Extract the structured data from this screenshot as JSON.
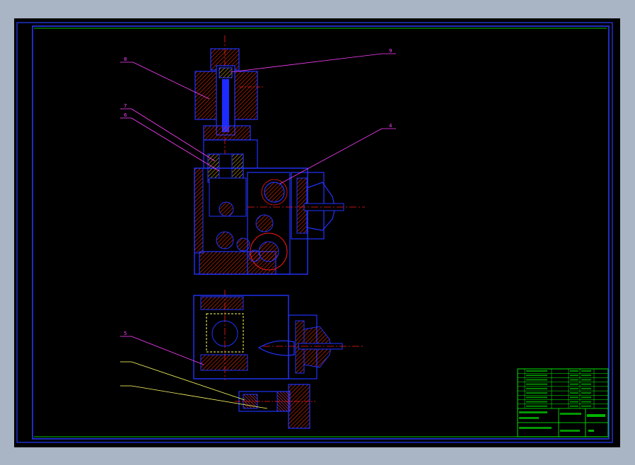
{
  "drawing": {
    "balloons": [
      "8",
      "9",
      "7",
      "6",
      "4",
      "5",
      "",
      ""
    ],
    "colors": {
      "background": "#000000",
      "border": "#2b3cff",
      "section": "#2233ff",
      "hatch": "#ff3300",
      "centerline": "#ff1a1a",
      "leader": "#ff40ff",
      "leader_alt": "#ffff66",
      "title_block": "#00ff00"
    }
  }
}
